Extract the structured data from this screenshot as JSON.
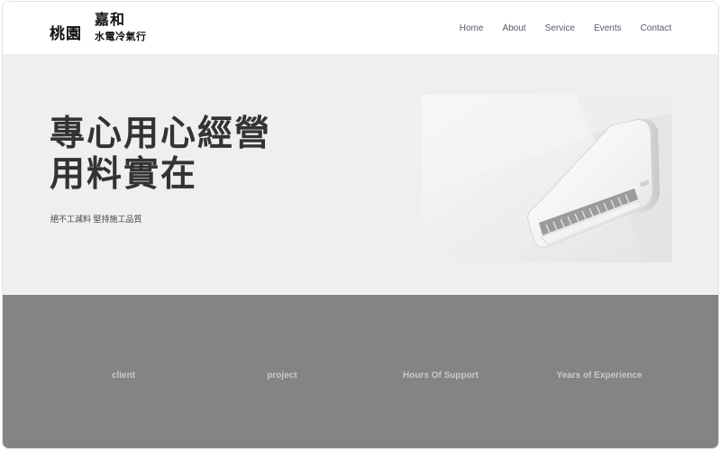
{
  "header": {
    "brand_city": "桃園",
    "brand_name": "嘉和",
    "brand_sub": "水電冷氣行",
    "nav": [
      "Home",
      "About",
      "Service",
      "Events",
      "Contact"
    ]
  },
  "hero": {
    "title_line1": "專心用心經營",
    "title_line2": "用料實在",
    "subtitle": "絕不工減料 堅持施工品質",
    "image_icon": "air-conditioner-image"
  },
  "stats": {
    "labels": [
      "client",
      "project",
      "Hours Of Support",
      "Years of Experience"
    ]
  },
  "colors": {
    "hero_bg": "#efeff0",
    "stats_bg": "#848484",
    "nav_text": "#555a66",
    "title_text": "#333333"
  }
}
